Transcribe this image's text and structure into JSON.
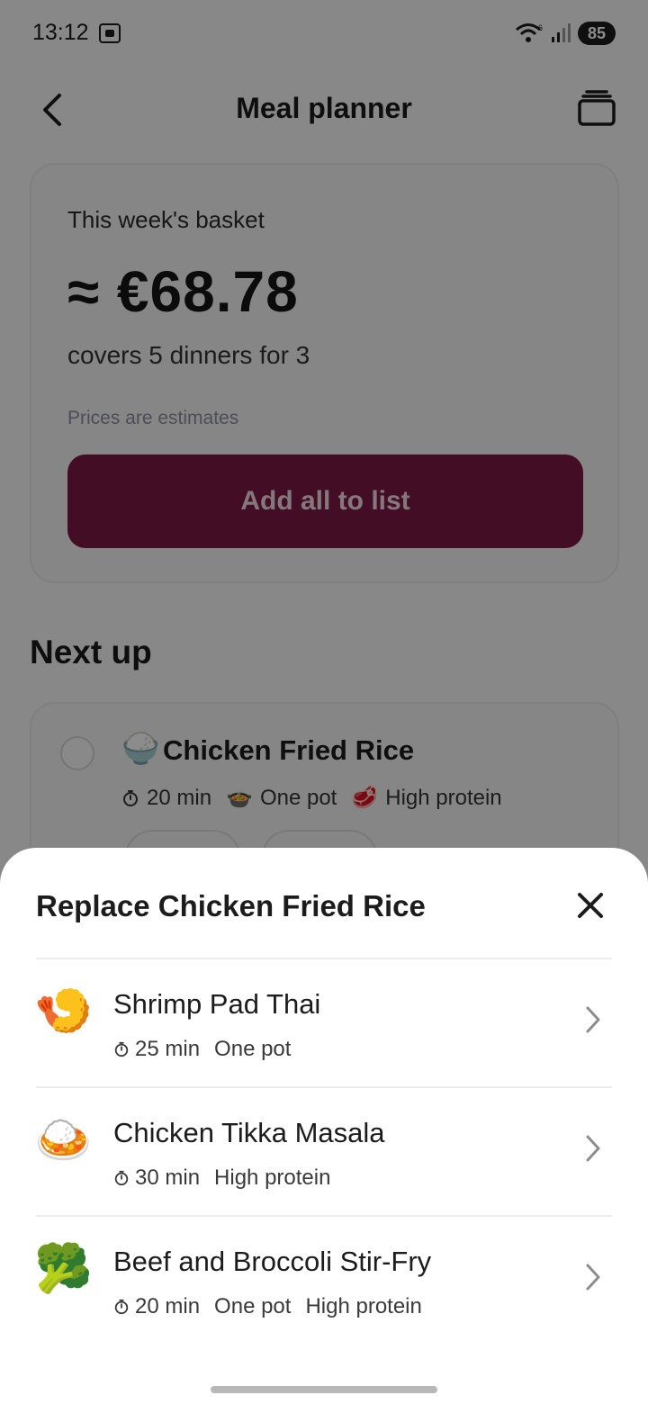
{
  "status_bar": {
    "time": "13:12",
    "battery": "85",
    "icons": [
      "screen-record-icon",
      "wifi-icon",
      "signal-icon",
      "battery-icon"
    ]
  },
  "header": {
    "title": "Meal planner",
    "back_icon": "back-chevron-icon",
    "archive_icon": "archive-icon"
  },
  "basket": {
    "label": "This week's basket",
    "price": "≈ €68.78",
    "covers": "covers 5 dinners for 3",
    "note": "Prices are estimates",
    "button_label": "Add all to list"
  },
  "next_up": {
    "title": "Next up",
    "meal": {
      "emoji": "🍚",
      "title": "Chicken Fried Rice",
      "time": "20 min",
      "tag1_emoji": "🍲",
      "tag1": "One pot",
      "tag2_emoji": "🥩",
      "tag2": "High protein"
    }
  },
  "sheet": {
    "title": "Replace Chicken Fried Rice",
    "close_icon": "close-icon",
    "options": [
      {
        "emoji": "🍤",
        "title": "Shrimp Pad Thai",
        "time": "25 min",
        "tags": [
          "One pot"
        ]
      },
      {
        "emoji": "🍛",
        "title": "Chicken Tikka Masala",
        "time": "30 min",
        "tags": [
          "High protein"
        ]
      },
      {
        "emoji": "🥦",
        "title": "Beef and Broccoli Stir-Fry",
        "time": "20 min",
        "tags": [
          "One pot",
          "High protein"
        ]
      }
    ]
  },
  "colors": {
    "accent": "#7a1846",
    "button_text": "#f0dbe4",
    "scrim": "rgba(0,0,0,0.45)"
  }
}
